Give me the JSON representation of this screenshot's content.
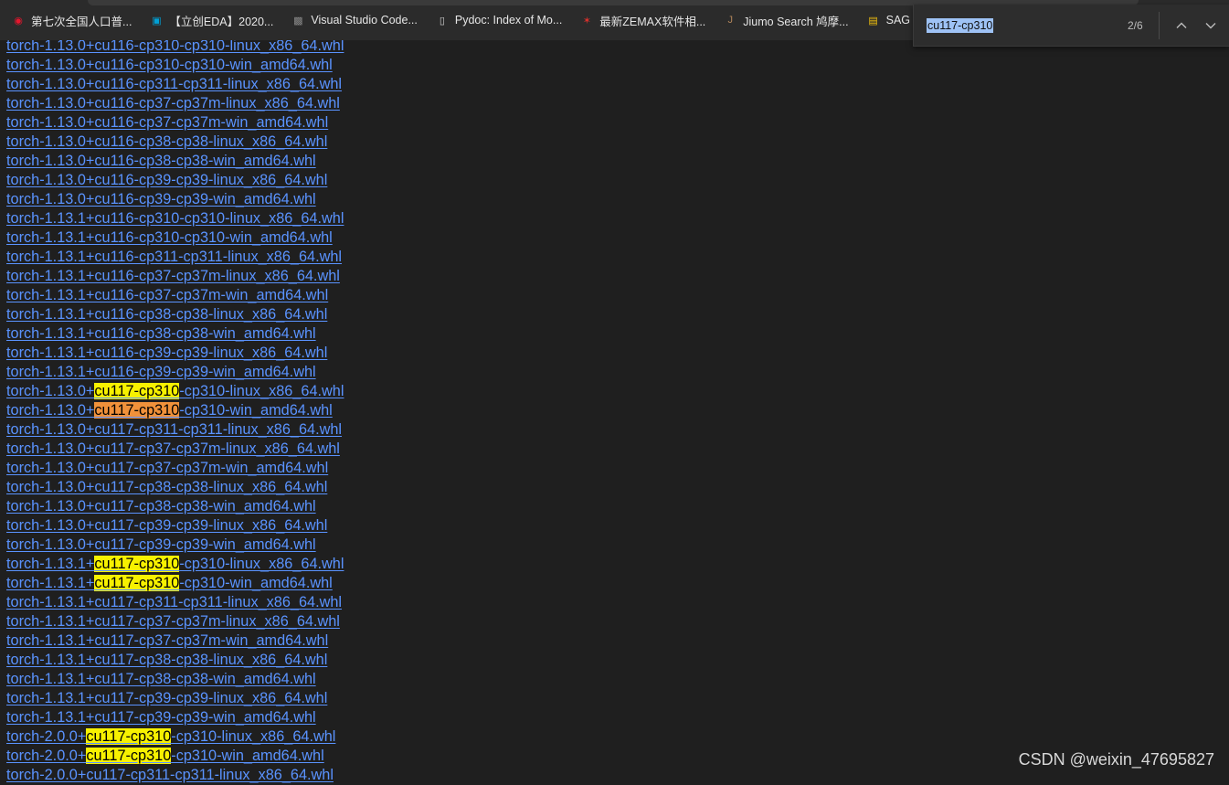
{
  "bookmarks": [
    {
      "label": "第七次全国人口普...",
      "icon": "weibo-icon",
      "color": "#e6162d"
    },
    {
      "label": "【立创EDA】2020...",
      "icon": "bilibili-tv-icon",
      "color": "#00a1d6"
    },
    {
      "label": "Visual Studio Code...",
      "icon": "thumbnail-icon",
      "color": "#888888"
    },
    {
      "label": "Pydoc: Index of Mo...",
      "icon": "page-icon",
      "color": "#cccccc"
    },
    {
      "label": "最新ZEMAX软件相...",
      "icon": "zemax-icon",
      "color": "#d9302c"
    },
    {
      "label": "Jiumo Search 鸠摩...",
      "icon": "jiumo-icon",
      "color": "#b0855a"
    },
    {
      "label": "SAG Calculator",
      "icon": "sag-icon",
      "color": "#f4c20d"
    }
  ],
  "find_bar": {
    "query": "cu117-cp310",
    "count": "2/6"
  },
  "files": [
    {
      "pre": "torch-1.13.0+cu116-cp310-cp310-linux_x86_64.whl",
      "match": "",
      "post": "",
      "current": false
    },
    {
      "pre": "torch-1.13.0+cu116-cp310-cp310-win_amd64.whl",
      "match": "",
      "post": "",
      "current": false
    },
    {
      "pre": "torch-1.13.0+cu116-cp311-cp311-linux_x86_64.whl",
      "match": "",
      "post": "",
      "current": false
    },
    {
      "pre": "torch-1.13.0+cu116-cp37-cp37m-linux_x86_64.whl",
      "match": "",
      "post": "",
      "current": false
    },
    {
      "pre": "torch-1.13.0+cu116-cp37-cp37m-win_amd64.whl",
      "match": "",
      "post": "",
      "current": false
    },
    {
      "pre": "torch-1.13.0+cu116-cp38-cp38-linux_x86_64.whl",
      "match": "",
      "post": "",
      "current": false
    },
    {
      "pre": "torch-1.13.0+cu116-cp38-cp38-win_amd64.whl",
      "match": "",
      "post": "",
      "current": false
    },
    {
      "pre": "torch-1.13.0+cu116-cp39-cp39-linux_x86_64.whl",
      "match": "",
      "post": "",
      "current": false
    },
    {
      "pre": "torch-1.13.0+cu116-cp39-cp39-win_amd64.whl",
      "match": "",
      "post": "",
      "current": false
    },
    {
      "pre": "torch-1.13.1+cu116-cp310-cp310-linux_x86_64.whl",
      "match": "",
      "post": "",
      "current": false
    },
    {
      "pre": "torch-1.13.1+cu116-cp310-cp310-win_amd64.whl",
      "match": "",
      "post": "",
      "current": false
    },
    {
      "pre": "torch-1.13.1+cu116-cp311-cp311-linux_x86_64.whl",
      "match": "",
      "post": "",
      "current": false
    },
    {
      "pre": "torch-1.13.1+cu116-cp37-cp37m-linux_x86_64.whl",
      "match": "",
      "post": "",
      "current": false
    },
    {
      "pre": "torch-1.13.1+cu116-cp37-cp37m-win_amd64.whl",
      "match": "",
      "post": "",
      "current": false
    },
    {
      "pre": "torch-1.13.1+cu116-cp38-cp38-linux_x86_64.whl",
      "match": "",
      "post": "",
      "current": false
    },
    {
      "pre": "torch-1.13.1+cu116-cp38-cp38-win_amd64.whl",
      "match": "",
      "post": "",
      "current": false
    },
    {
      "pre": "torch-1.13.1+cu116-cp39-cp39-linux_x86_64.whl",
      "match": "",
      "post": "",
      "current": false
    },
    {
      "pre": "torch-1.13.1+cu116-cp39-cp39-win_amd64.whl",
      "match": "",
      "post": "",
      "current": false
    },
    {
      "pre": "torch-1.13.0+",
      "match": "cu117-cp310",
      "post": "-cp310-linux_x86_64.whl",
      "current": false
    },
    {
      "pre": "torch-1.13.0+",
      "match": "cu117-cp310",
      "post": "-cp310-win_amd64.whl",
      "current": true
    },
    {
      "pre": "torch-1.13.0+cu117-cp311-cp311-linux_x86_64.whl",
      "match": "",
      "post": "",
      "current": false
    },
    {
      "pre": "torch-1.13.0+cu117-cp37-cp37m-linux_x86_64.whl",
      "match": "",
      "post": "",
      "current": false
    },
    {
      "pre": "torch-1.13.0+cu117-cp37-cp37m-win_amd64.whl",
      "match": "",
      "post": "",
      "current": false
    },
    {
      "pre": "torch-1.13.0+cu117-cp38-cp38-linux_x86_64.whl",
      "match": "",
      "post": "",
      "current": false
    },
    {
      "pre": "torch-1.13.0+cu117-cp38-cp38-win_amd64.whl",
      "match": "",
      "post": "",
      "current": false
    },
    {
      "pre": "torch-1.13.0+cu117-cp39-cp39-linux_x86_64.whl",
      "match": "",
      "post": "",
      "current": false
    },
    {
      "pre": "torch-1.13.0+cu117-cp39-cp39-win_amd64.whl",
      "match": "",
      "post": "",
      "current": false
    },
    {
      "pre": "torch-1.13.1+",
      "match": "cu117-cp310",
      "post": "-cp310-linux_x86_64.whl",
      "current": false
    },
    {
      "pre": "torch-1.13.1+",
      "match": "cu117-cp310",
      "post": "-cp310-win_amd64.whl",
      "current": false
    },
    {
      "pre": "torch-1.13.1+cu117-cp311-cp311-linux_x86_64.whl",
      "match": "",
      "post": "",
      "current": false
    },
    {
      "pre": "torch-1.13.1+cu117-cp37-cp37m-linux_x86_64.whl",
      "match": "",
      "post": "",
      "current": false
    },
    {
      "pre": "torch-1.13.1+cu117-cp37-cp37m-win_amd64.whl",
      "match": "",
      "post": "",
      "current": false
    },
    {
      "pre": "torch-1.13.1+cu117-cp38-cp38-linux_x86_64.whl",
      "match": "",
      "post": "",
      "current": false
    },
    {
      "pre": "torch-1.13.1+cu117-cp38-cp38-win_amd64.whl",
      "match": "",
      "post": "",
      "current": false
    },
    {
      "pre": "torch-1.13.1+cu117-cp39-cp39-linux_x86_64.whl",
      "match": "",
      "post": "",
      "current": false
    },
    {
      "pre": "torch-1.13.1+cu117-cp39-cp39-win_amd64.whl",
      "match": "",
      "post": "",
      "current": false
    },
    {
      "pre": "torch-2.0.0+",
      "match": "cu117-cp310",
      "post": "-cp310-linux_x86_64.whl",
      "current": false
    },
    {
      "pre": "torch-2.0.0+",
      "match": "cu117-cp310",
      "post": "-cp310-win_amd64.whl",
      "current": false
    },
    {
      "pre": "torch-2.0.0+cu117-cp311-cp311-linux_x86_64.whl",
      "match": "",
      "post": "",
      "current": false
    }
  ],
  "watermark": "CSDN @weixin_47695827",
  "colors": {
    "background": "#1f1f1f",
    "link": "#5a93ff",
    "match_highlight": "#f7f100",
    "current_match_highlight": "#f0913a"
  }
}
